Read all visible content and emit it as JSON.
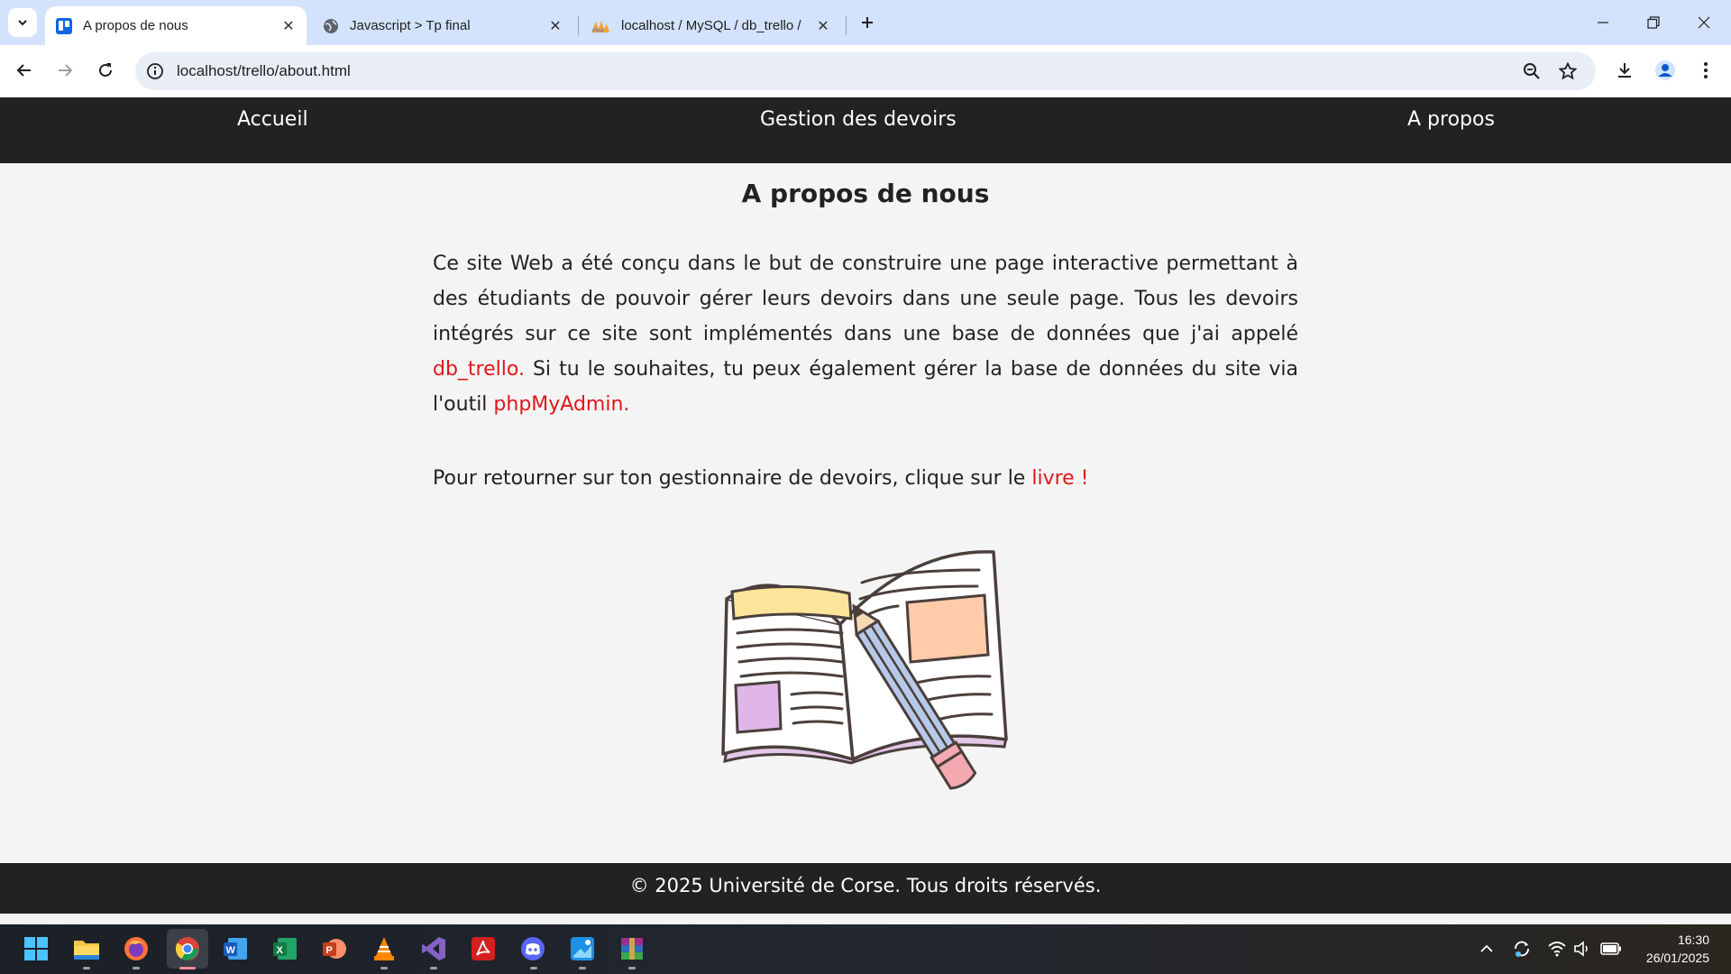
{
  "browser": {
    "tabs": [
      {
        "title": "A propos de nous",
        "favicon": "trello-icon",
        "active": true
      },
      {
        "title": "Javascript > Tp final",
        "favicon": "globe-icon",
        "active": false
      },
      {
        "title": "localhost / MySQL / db_trello /",
        "favicon": "phpmyadmin-icon",
        "active": false
      }
    ],
    "url": "localhost/trello/about.html"
  },
  "site": {
    "nav": {
      "home": "Accueil",
      "tasks": "Gestion des devoirs",
      "about": "A propos"
    },
    "title": "A propos de nous",
    "para1": {
      "text_a": "Ce site Web a été conçu dans le but de construire une page interactive permettant à des étudiants de pouvoir gérer leurs devoirs dans une seule page. Tous les devoirs intégrés sur ce site sont implémentés dans une base de données que j'ai appelé ",
      "link_db": "db_trello.",
      "text_b": " Si tu le souhaites, tu peux également gérer la base de données du site via l'outil ",
      "link_pma": "phpMyAdmin."
    },
    "para2": {
      "text": "Pour retourner sur ton gestionnaire de devoirs, clique sur le ",
      "link": "livre !"
    },
    "footer": "© 2025 Université de Corse. Tous droits réservés."
  },
  "taskbar": {
    "apps": [
      "windows-start-icon",
      "file-explorer-icon",
      "firefox-icon",
      "chrome-icon",
      "word-icon",
      "excel-icon",
      "powerpoint-icon",
      "vlc-icon",
      "visual-studio-icon",
      "acrobat-icon",
      "discord-icon",
      "paint-icon",
      "winrar-icon"
    ],
    "time": "16:30",
    "date": "26/01/2025"
  },
  "colors": {
    "link": "#e0161b",
    "nav_bg": "#222222",
    "page_bg": "#f4f4f4",
    "tabstrip_bg": "#d3e3fd"
  }
}
